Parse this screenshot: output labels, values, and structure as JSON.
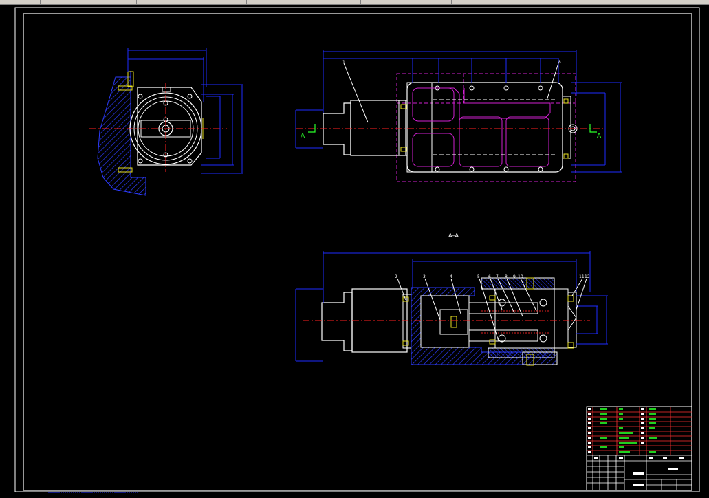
{
  "section_label": "A–A",
  "section_marks": [
    "A",
    "A"
  ],
  "balloons_top": [
    "1",
    "8"
  ],
  "balloons_section": [
    "2",
    "3",
    "4",
    "5",
    "6",
    "7",
    "8",
    "9",
    "10",
    "11",
    "12"
  ],
  "colors": {
    "background": "#000000",
    "frame": "#ffffff",
    "outline": "#ffffff",
    "dimension": "#1e2cff",
    "centerline": "#ff2020",
    "hatch": "#2d3cff",
    "phantom": "#d020d0",
    "title_red": "#ff3030",
    "title_green": "#20d020"
  }
}
